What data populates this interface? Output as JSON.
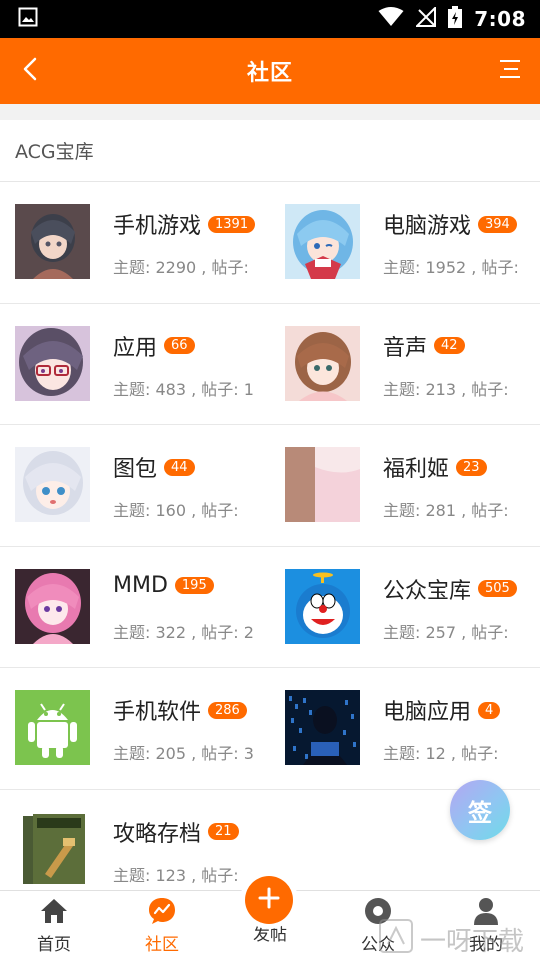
{
  "status_bar": {
    "time": "7:08"
  },
  "nav": {
    "title": "社区",
    "back_icon": "chevron-left-icon",
    "menu_icon": "menu-icon"
  },
  "section": {
    "title": "ACG宝库"
  },
  "forums": [
    {
      "name": "手机游戏",
      "badge": "1391",
      "meta": "主题: 2290 , 帖子:"
    },
    {
      "name": "电脑游戏",
      "badge": "394",
      "meta": "主题: 1952 , 帖子:"
    },
    {
      "name": "应用",
      "badge": "66",
      "meta": "主题: 483 , 帖子: 1"
    },
    {
      "name": "音声",
      "badge": "42",
      "meta": "主题: 213 , 帖子:"
    },
    {
      "name": "图包",
      "badge": "44",
      "meta": "主题: 160 , 帖子:"
    },
    {
      "name": "福利姬",
      "badge": "23",
      "meta": "主题: 281 , 帖子:"
    },
    {
      "name": "MMD",
      "badge": "195",
      "meta": "主题: 322 , 帖子: 2"
    },
    {
      "name": "公众宝库",
      "badge": "505",
      "meta": "主题: 257 , 帖子:"
    },
    {
      "name": "手机软件",
      "badge": "286",
      "meta": "主题: 205 , 帖子: 3"
    },
    {
      "name": "电脑应用",
      "badge": "4",
      "meta": "主题: 12 , 帖子:"
    },
    {
      "name": "攻略存档",
      "badge": "21",
      "meta": "主题: 123 , 帖子:"
    }
  ],
  "fab": {
    "label": "签"
  },
  "tabs": [
    {
      "label": "首页",
      "icon": "home-icon"
    },
    {
      "label": "社区",
      "icon": "community-icon"
    },
    {
      "label": "发帖",
      "icon": "plus-icon"
    },
    {
      "label": "公众",
      "icon": "public-icon"
    },
    {
      "label": "我的",
      "icon": "profile-icon"
    }
  ],
  "watermark": {
    "text": "一呀下载"
  },
  "colors": {
    "accent": "#ff6a00",
    "status_bar": "#000000"
  }
}
